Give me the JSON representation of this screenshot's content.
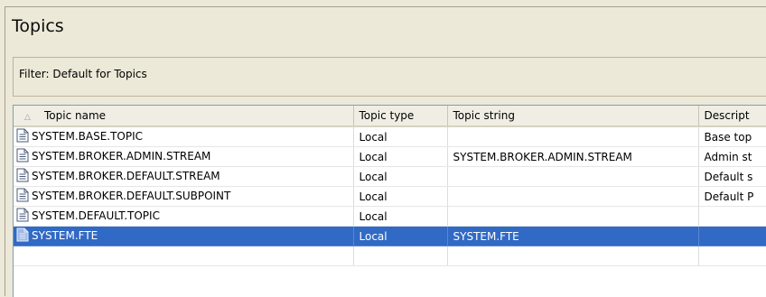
{
  "title": "Topics",
  "filter": {
    "label": "Filter: Default for Topics"
  },
  "table": {
    "columns": [
      "Topic name",
      "Topic type",
      "Topic string",
      "Descript"
    ],
    "rows": [
      {
        "name": "SYSTEM.BASE.TOPIC",
        "type": "Local",
        "string": "",
        "desc": "Base top"
      },
      {
        "name": "SYSTEM.BROKER.ADMIN.STREAM",
        "type": "Local",
        "string": "SYSTEM.BROKER.ADMIN.STREAM",
        "desc": "Admin st"
      },
      {
        "name": "SYSTEM.BROKER.DEFAULT.STREAM",
        "type": "Local",
        "string": "",
        "desc": "Default s"
      },
      {
        "name": "SYSTEM.BROKER.DEFAULT.SUBPOINT",
        "type": "Local",
        "string": "",
        "desc": "Default P"
      },
      {
        "name": "SYSTEM.DEFAULT.TOPIC",
        "type": "Local",
        "string": "",
        "desc": ""
      },
      {
        "name": "SYSTEM.FTE",
        "type": "Local",
        "string": "SYSTEM.FTE",
        "desc": ""
      }
    ],
    "selected_row": 5
  },
  "colors": {
    "selection": "#316ac5",
    "background": "#ece9d8"
  },
  "icons": {
    "row_icon": "document-icon",
    "sort_indicator": "sort-ascending-icon"
  }
}
